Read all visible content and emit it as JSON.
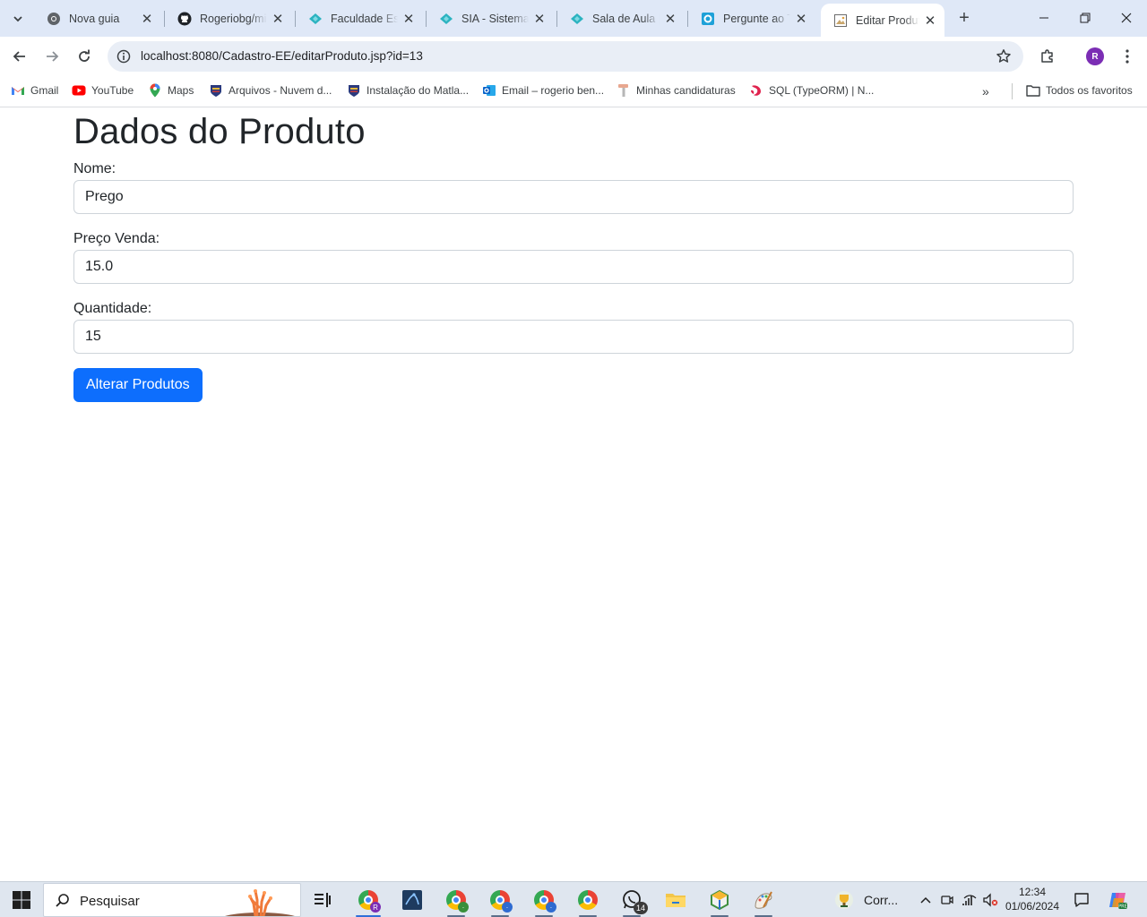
{
  "browser": {
    "tabs": [
      {
        "title": "Nova guia",
        "icon": "chrome-icon"
      },
      {
        "title": "Rogeriobg/mi",
        "icon": "github-icon"
      },
      {
        "title": "Faculdade Est",
        "icon": "diamond-icon"
      },
      {
        "title": "SIA - Sistema",
        "icon": "diamond-icon"
      },
      {
        "title": "Sala de Aula |",
        "icon": "diamond-icon"
      },
      {
        "title": "Pergunte ao T",
        "icon": "square-o-icon"
      },
      {
        "title": "Editar Produto",
        "icon": "page-icon",
        "active": true
      }
    ],
    "url": "localhost:8080/Cadastro-EE/editarProduto.jsp?id=13",
    "profile_initial": "R",
    "bookmarks": [
      {
        "label": "Gmail",
        "icon": "gmail-icon"
      },
      {
        "label": "YouTube",
        "icon": "youtube-icon"
      },
      {
        "label": "Maps",
        "icon": "maps-icon"
      },
      {
        "label": "Arquivos - Nuvem d...",
        "icon": "shield-icon"
      },
      {
        "label": "Instalação do Matla...",
        "icon": "shield-icon"
      },
      {
        "label": "Email – rogerio ben...",
        "icon": "outlook-icon"
      },
      {
        "label": "Minhas candidaturas",
        "icon": "hammer-icon"
      },
      {
        "label": "SQL (TypeORM) | N...",
        "icon": "nest-icon"
      }
    ],
    "all_bookmarks_label": "Todos os favoritos"
  },
  "page": {
    "title": "Dados do Produto",
    "fields": {
      "nome": {
        "label": "Nome:",
        "value": "Prego"
      },
      "preco": {
        "label": "Preço Venda:",
        "value": "15.0"
      },
      "quantidade": {
        "label": "Quantidade:",
        "value": "15"
      }
    },
    "submit_label": "Alterar Produtos"
  },
  "taskbar": {
    "search_placeholder": "Pesquisar",
    "running_app_label": "Corr...",
    "whatsapp_badge": "14",
    "time": "12:34",
    "date": "01/06/2024"
  },
  "colors": {
    "primary": "#0d6efd",
    "tabstrip": "#dfe8f7",
    "omnibox": "#e9eef6",
    "avatar": "#7b2db4"
  }
}
